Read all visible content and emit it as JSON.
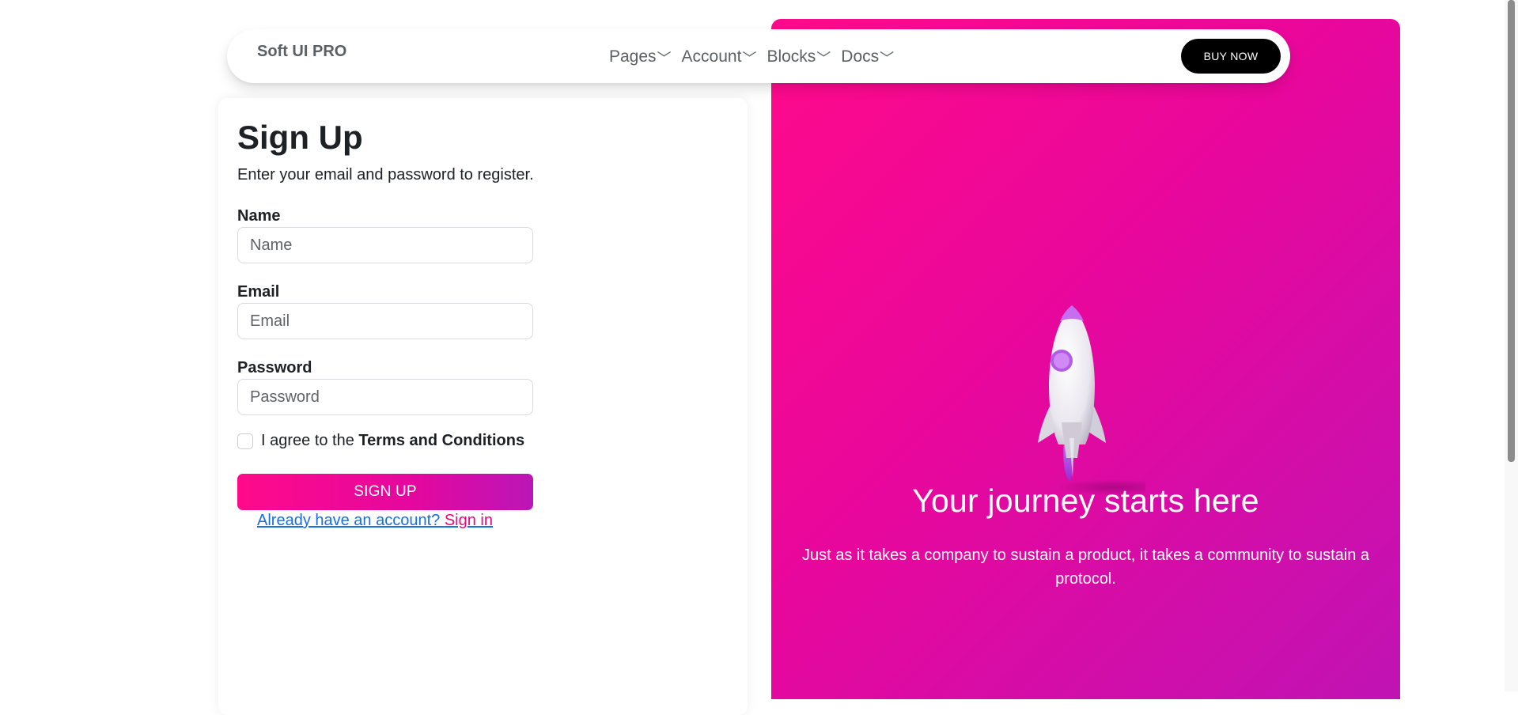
{
  "navbar": {
    "brand": "Soft UI PRO",
    "links": [
      {
        "label": "Pages",
        "chevron": "﹀"
      },
      {
        "label": "Account",
        "chevron": "﹀"
      },
      {
        "label": "Blocks",
        "chevron": "﹀"
      },
      {
        "label": "Docs",
        "chevron": "﹀"
      }
    ],
    "cta_label": "BUY NOW"
  },
  "form": {
    "title": "Sign Up",
    "subtitle": "Enter your email and password to register.",
    "fields": {
      "name": {
        "label": "Name",
        "placeholder": "Name",
        "value": ""
      },
      "email": {
        "label": "Email",
        "placeholder": "Email",
        "value": ""
      },
      "password": {
        "label": "Password",
        "placeholder": "Password",
        "value": ""
      }
    },
    "terms": {
      "prefix": "I agree to the ",
      "link": "Terms and Conditions",
      "checked": false
    },
    "submit_label": "SIGN UP",
    "signin_prompt": "Already have an account? ",
    "signin_link": "Sign in"
  },
  "hero": {
    "title": "Your journey starts here",
    "subtitle": "Just as it takes a company to sustain a product, it takes a community to sustain a protocol.",
    "illustration": "rocket-icon"
  },
  "colors": {
    "gradient_start": "#ff0a8a",
    "gradient_end": "#c013b4",
    "cta_background": "#000000",
    "link_blue": "#1a6fe0",
    "link_pink": "#e6087e"
  }
}
